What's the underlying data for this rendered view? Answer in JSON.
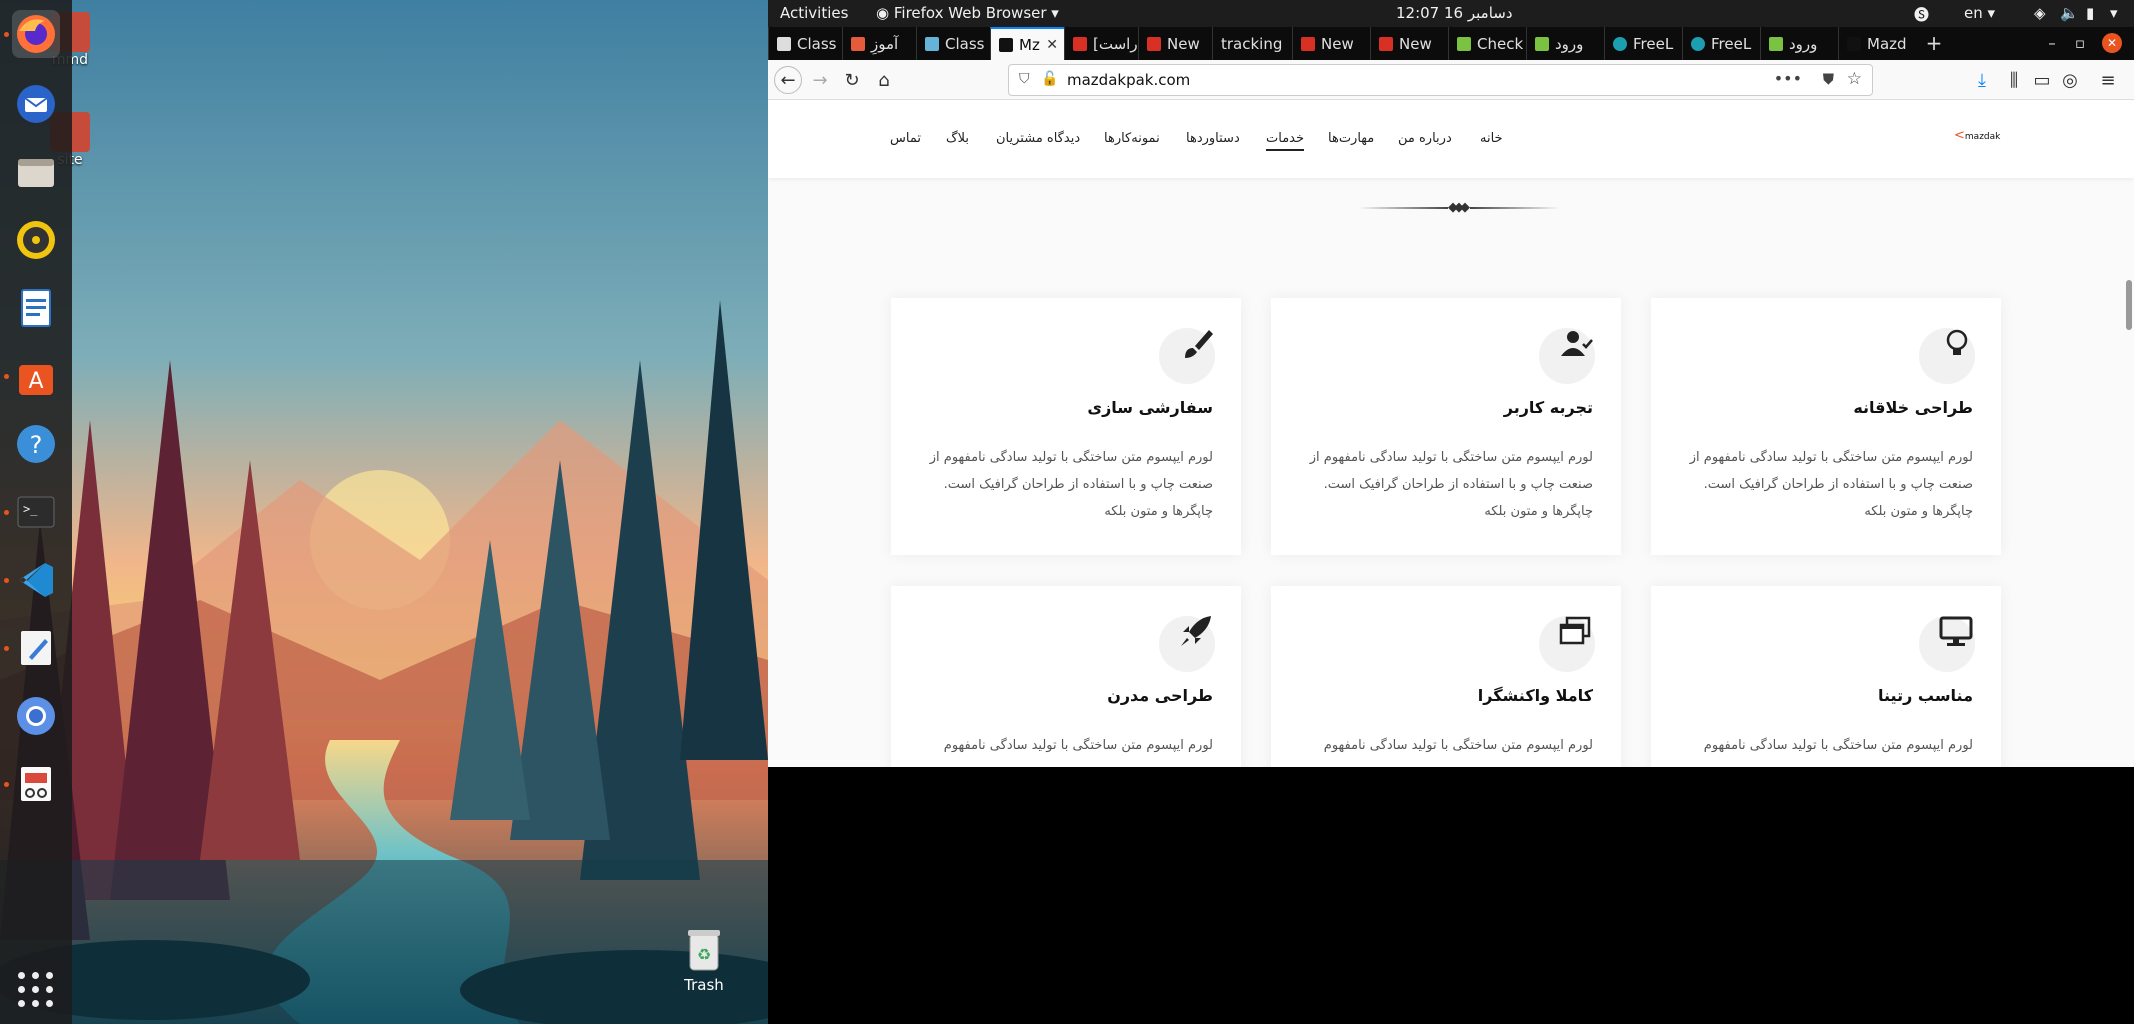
{
  "desktop": {
    "icons": [
      {
        "label": "mmd"
      },
      {
        "label": "site"
      }
    ],
    "trash_label": "Trash"
  },
  "dock": {
    "apps": [
      {
        "name": "firefox-icon"
      },
      {
        "name": "thunderbird-icon"
      },
      {
        "name": "files-icon"
      },
      {
        "name": "rhythmbox-icon"
      },
      {
        "name": "libreoffice-writer-icon"
      },
      {
        "name": "software-center-icon"
      },
      {
        "name": "help-icon"
      },
      {
        "name": "terminal-icon"
      },
      {
        "name": "vscode-icon"
      },
      {
        "name": "text-editor-icon"
      },
      {
        "name": "chromium-icon"
      },
      {
        "name": "document-viewer-icon"
      }
    ]
  },
  "topbar": {
    "activities": "Activities",
    "app_menu": "Firefox Web Browser ▾",
    "clock": "دسامبر 16  12:07",
    "lang": "en ▾"
  },
  "browser": {
    "tabs": [
      {
        "label": "Class",
        "color": "#dddddd"
      },
      {
        "label": "آموزِ",
        "color": "#e55b3c"
      },
      {
        "label": "Class",
        "color": "#66b3d9"
      },
      {
        "label": "Mz",
        "color": "#111111"
      },
      {
        "label": "[راست",
        "color": "#d93025"
      },
      {
        "label": "New",
        "color": "#d93025"
      },
      {
        "label": "tracking",
        "color": ""
      },
      {
        "label": "New",
        "color": "#d93025"
      },
      {
        "label": "New",
        "color": "#d93025"
      },
      {
        "label": "Check",
        "color": "#7cc242"
      },
      {
        "label": "ورود",
        "color": "#7cc242"
      },
      {
        "label": "FreeL",
        "color": "#1c9fb0"
      },
      {
        "label": "FreeL",
        "color": "#1c9fb0"
      },
      {
        "label": "ورود",
        "color": "#7cc242"
      },
      {
        "label": "Mazd",
        "color": "#111111"
      }
    ],
    "url": "mazdakpak.com"
  },
  "site": {
    "logo_text": "mazdak",
    "menu": [
      "خانه",
      "درباره من",
      "مهارت‌ها",
      "خدمات",
      "دستاوردها",
      "نمونه‌کارها",
      "دیدگاه مشتریان",
      "بلاگ",
      "تماس"
    ],
    "current_menu": "خدمات",
    "cards": [
      {
        "title": "طراحی خلاقانه",
        "icon": "lightbulb-icon",
        "desc": "لورم ایپسوم متن ساختگی با تولید سادگی نامفهوم از صنعت چاپ و با استفاده از طراحان گرافیک است. چاپگرها و متون بلکه"
      },
      {
        "title": "تجربه کاربر",
        "icon": "user-check-icon",
        "desc": "لورم ایپسوم متن ساختگی با تولید سادگی نامفهوم از صنعت چاپ و با استفاده از طراحان گرافیک است. چاپگرها و متون بلکه"
      },
      {
        "title": "سفارشی سازی",
        "icon": "paintbrush-icon",
        "desc": "لورم ایپسوم متن ساختگی با تولید سادگی نامفهوم از صنعت چاپ و با استفاده از طراحان گرافیک است. چاپگرها و متون بلکه"
      },
      {
        "title": "مناسب رتینا",
        "icon": "desktop-icon",
        "desc": "لورم ایپسوم متن ساختگی با تولید سادگی نامفهوم"
      },
      {
        "title": "کاملا واکنشگرا",
        "icon": "windows-icon",
        "desc": "لورم ایپسوم متن ساختگی با تولید سادگی نامفهوم"
      },
      {
        "title": "طراحی مدرن",
        "icon": "rocket-icon",
        "desc": "لورم ایپسوم متن ساختگی با تولید سادگی نامفهوم"
      }
    ]
  }
}
